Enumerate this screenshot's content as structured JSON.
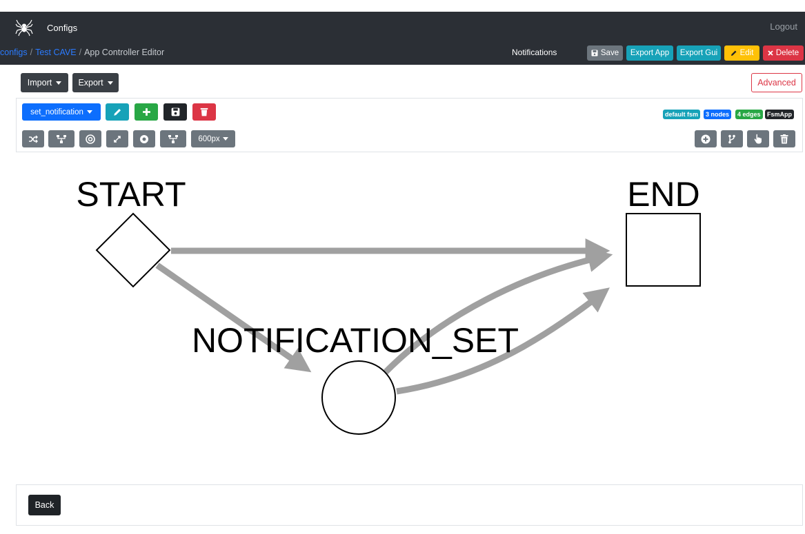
{
  "header": {
    "app_title": "Configs",
    "logout_label": "Logout",
    "notifications_label": "Notifications"
  },
  "breadcrumb": {
    "items": [
      "configs",
      "Test CAVE",
      "App Controller Editor"
    ]
  },
  "actions": {
    "save_label": "Save",
    "export_app_label": "Export App",
    "export_gui_label": "Export Gui",
    "edit_label": "Edit",
    "delete_label": "Delete"
  },
  "menus": {
    "import_label": "Import",
    "export_label": "Export",
    "advanced_label": "Advanced"
  },
  "editor": {
    "fsm_select_value": "set_notification",
    "width_select_value": "600px",
    "badges": [
      "default fsm",
      "3 nodes",
      "4 edges",
      "FsmApp"
    ]
  },
  "graph": {
    "nodes": [
      {
        "id": "start",
        "label": "START",
        "shape": "diamond"
      },
      {
        "id": "end",
        "label": "END",
        "shape": "square"
      },
      {
        "id": "notification_set",
        "label": "NOTIFICATION_SET",
        "shape": "circle"
      }
    ],
    "edges": [
      {
        "from": "START",
        "to": "END"
      },
      {
        "from": "START",
        "to": "NOTIFICATION_SET"
      },
      {
        "from": "NOTIFICATION_SET",
        "to": "END"
      },
      {
        "from": "NOTIFICATION_SET",
        "to": "END"
      }
    ]
  },
  "footer": {
    "back_label": "Back"
  },
  "colors": {
    "navbar": "#2b2f35",
    "primary": "#0d6efd",
    "info": "#17a2b8",
    "success": "#28a745",
    "warning": "#ffc107",
    "danger": "#dc3545",
    "secondary": "#6c757d",
    "edge": "#a0a0a0"
  },
  "icons": [
    "spider-logo-icon",
    "floppy-icon",
    "pencil-icon",
    "close-icon",
    "plus-icon",
    "save-icon",
    "trash-icon",
    "shuffle-icon",
    "hierarchy-icon",
    "target-icon",
    "expand-icon",
    "record-icon",
    "plus-circle-icon",
    "branch-icon",
    "pointer-hand-icon",
    "delete-icon"
  ]
}
